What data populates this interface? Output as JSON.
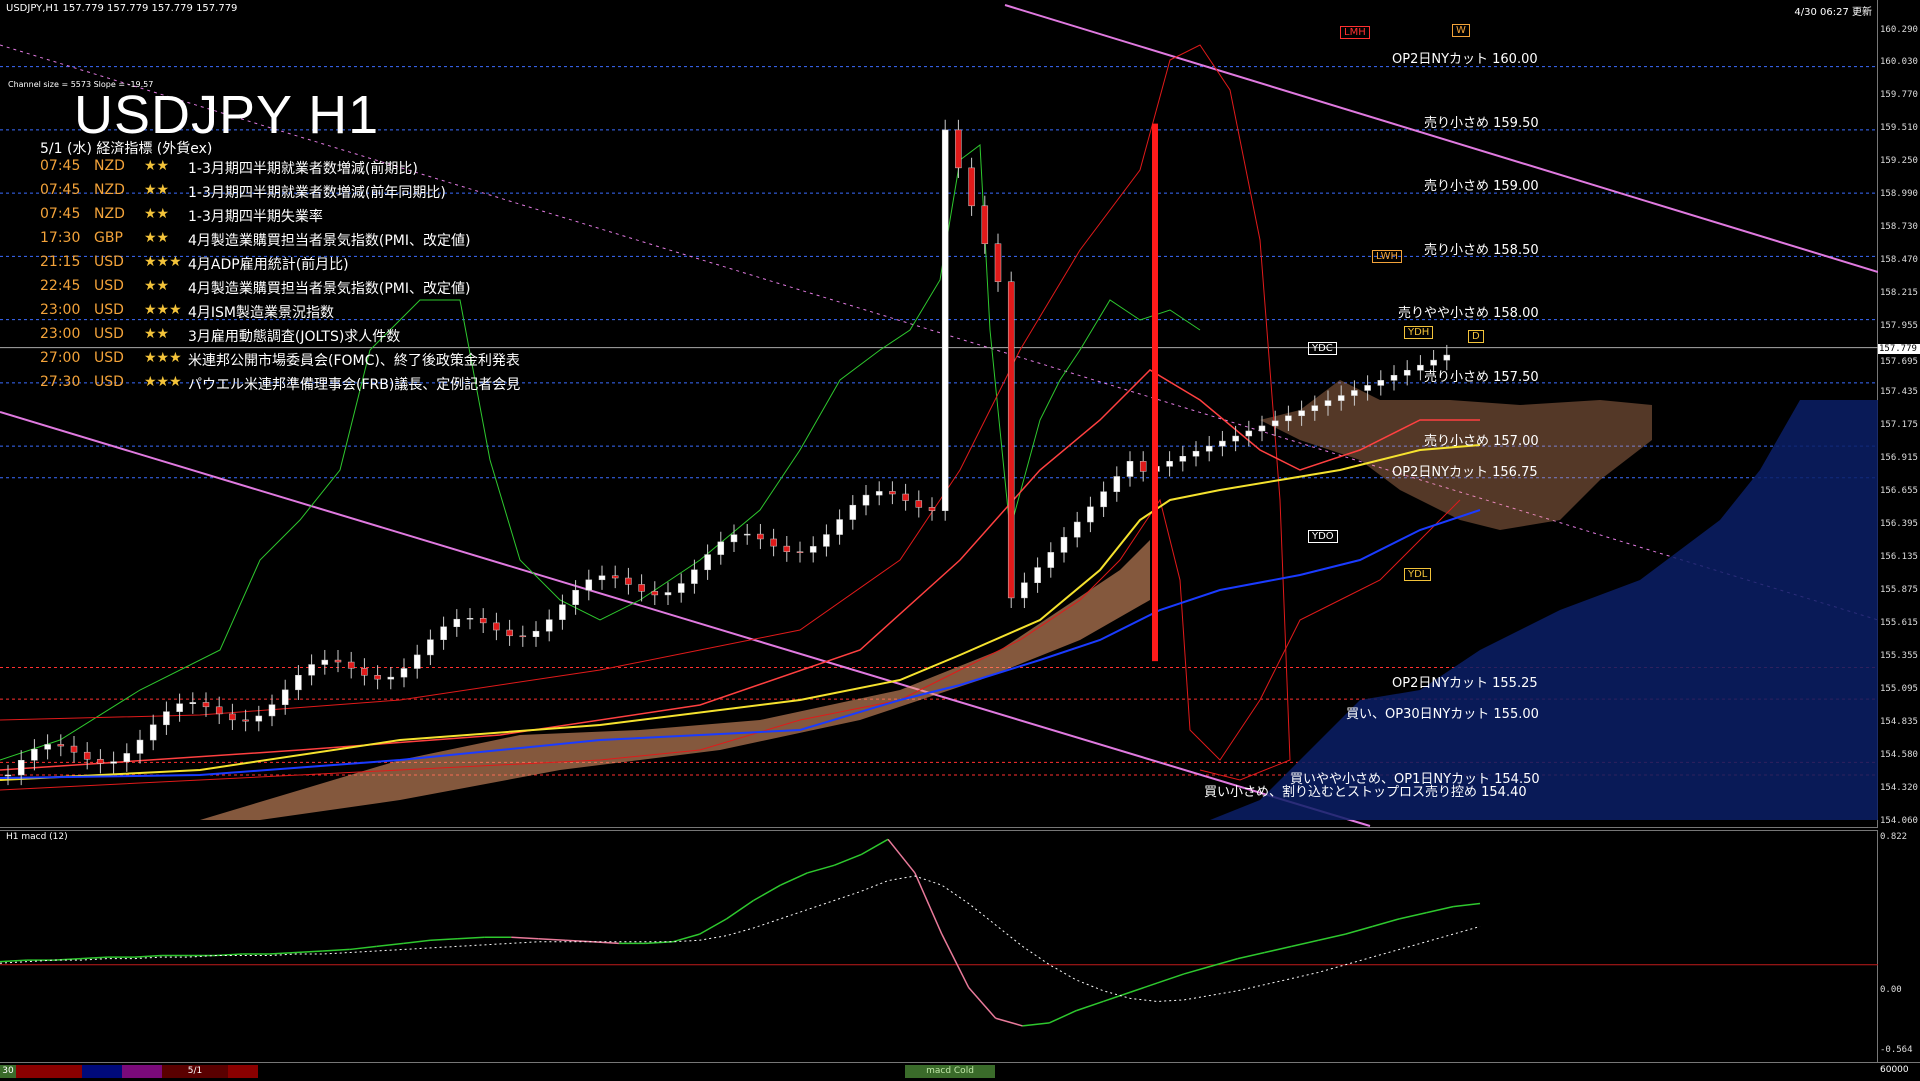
{
  "header": {
    "symbol_line": "USDJPY,H1  157.779 157.779 157.779 157.779",
    "server_time": "4/30 06:27 更新",
    "channel_info": "Channel size = 5573 Slope = -19.57"
  },
  "title": "USDJPY H1",
  "events_date": "5/1 (水) 経済指標 (外貨ex)",
  "events": [
    {
      "time": "07:45",
      "ccy": "NZD",
      "stars": "★★",
      "title": "1-3月期四半期就業者数増減(前期比)"
    },
    {
      "time": "07:45",
      "ccy": "NZD",
      "stars": "★★",
      "title": "1-3月期四半期就業者数増減(前年同期比)"
    },
    {
      "time": "07:45",
      "ccy": "NZD",
      "stars": "★★",
      "title": "1-3月期四半期失業率"
    },
    {
      "time": "17:30",
      "ccy": "GBP",
      "stars": "★★",
      "title": "4月製造業購買担当者景気指数(PMI、改定値)"
    },
    {
      "time": "21:15",
      "ccy": "USD",
      "stars": "★★★",
      "title": "4月ADP雇用統計(前月比)"
    },
    {
      "time": "22:45",
      "ccy": "USD",
      "stars": "★★",
      "title": "4月製造業購買担当者景気指数(PMI、改定値)"
    },
    {
      "time": "23:00",
      "ccy": "USD",
      "stars": "★★★",
      "title": "4月ISM製造業景況指数"
    },
    {
      "time": "23:00",
      "ccy": "USD",
      "stars": "★★",
      "title": "3月雇用動態調査(JOLTS)求人件数"
    },
    {
      "time": "27:00",
      "ccy": "USD",
      "stars": "★★★",
      "title": "米連邦公開市場委員会(FOMC)、終了後政策金利発表"
    },
    {
      "time": "27:30",
      "ccy": "USD",
      "stars": "★★★",
      "title": "パウエル米連邦準備理事会(FRB)議長、定例記者会見"
    }
  ],
  "levels": [
    {
      "label": "OP2日NYカット 160.00",
      "price": 160.0,
      "color": "#3b6cff"
    },
    {
      "label": "売り小さめ 159.50",
      "price": 159.5,
      "color": "#3b6cff"
    },
    {
      "label": "売り小さめ 159.00",
      "price": 159.0,
      "color": "#3b6cff"
    },
    {
      "label": "売り小さめ 158.50",
      "price": 158.5,
      "color": "#3b6cff"
    },
    {
      "label": "売りやや小さめ 158.00",
      "price": 158.0,
      "color": "#3b6cff"
    },
    {
      "label": "売り小さめ 157.50",
      "price": 157.5,
      "color": "#3b6cff"
    },
    {
      "label": "売り小さめ 157.00",
      "price": 157.0,
      "color": "#3b6cff"
    },
    {
      "label": "OP2日NYカット 156.75",
      "price": 156.75,
      "color": "#3b6cff"
    },
    {
      "label": "OP2日NYカット 155.25",
      "price": 155.25,
      "color": "#ff3030"
    },
    {
      "label": "買い、OP30日NYカット 155.00",
      "price": 155.0,
      "color": "#ff3030"
    },
    {
      "label": "買いやや小さめ、OP1日NYカット 154.50",
      "price": 154.5,
      "color": "#ff3030"
    },
    {
      "label": "買い小さめ、割り込むとストップロス売り控め 154.40",
      "price": 154.4,
      "color": "#ff3030"
    }
  ],
  "tags": [
    {
      "text": "LMH",
      "color": "#ff3030"
    },
    {
      "text": "W",
      "color": "#f3a33a"
    },
    {
      "text": "LWH",
      "color": "#f3a33a"
    },
    {
      "text": "YDH",
      "color": "#f3c33a"
    },
    {
      "text": "D",
      "color": "#f3c33a"
    },
    {
      "text": "YDC",
      "color": "#ffffff"
    },
    {
      "text": "YDO",
      "color": "#ffffff"
    },
    {
      "text": "YDL",
      "color": "#f3c33a"
    }
  ],
  "price_axis": {
    "ticks": [
      "160.290",
      "160.030",
      "159.770",
      "159.510",
      "159.250",
      "158.990",
      "158.730",
      "158.470",
      "158.215",
      "157.955",
      "157.695",
      "157.435",
      "157.175",
      "156.915",
      "156.655",
      "156.395",
      "156.135",
      "155.875",
      "155.615",
      "155.355",
      "155.095",
      "154.835",
      "154.580",
      "154.320",
      "154.060"
    ],
    "current_price": "157.779",
    "max": 160.29,
    "min": 154.06
  },
  "macd": {
    "label": "H1  macd (12)",
    "ticks": [
      "0.822",
      "0.00",
      "-0.564"
    ],
    "main": [
      0.02,
      0.03,
      0.03,
      0.04,
      0.05,
      0.05,
      0.06,
      0.06,
      0.06,
      0.07,
      0.07,
      0.08,
      0.09,
      0.1,
      0.12,
      0.14,
      0.16,
      0.17,
      0.18,
      0.18,
      0.17,
      0.16,
      0.15,
      0.14,
      0.14,
      0.15,
      0.2,
      0.3,
      0.42,
      0.52,
      0.6,
      0.65,
      0.72,
      0.82,
      0.6,
      0.2,
      -0.15,
      -0.35,
      -0.4,
      -0.38,
      -0.3,
      -0.24,
      -0.18,
      -0.12,
      -0.06,
      -0.01,
      0.04,
      0.08,
      0.12,
      0.16,
      0.2,
      0.25,
      0.3,
      0.34,
      0.38,
      0.4
    ],
    "signal": [
      0.01,
      0.02,
      0.03,
      0.03,
      0.04,
      0.04,
      0.05,
      0.05,
      0.06,
      0.06,
      0.06,
      0.07,
      0.07,
      0.08,
      0.09,
      0.1,
      0.11,
      0.12,
      0.13,
      0.14,
      0.15,
      0.15,
      0.15,
      0.15,
      0.15,
      0.15,
      0.16,
      0.19,
      0.24,
      0.3,
      0.36,
      0.42,
      0.48,
      0.55,
      0.58,
      0.52,
      0.4,
      0.26,
      0.12,
      0.0,
      -0.1,
      -0.17,
      -0.22,
      -0.24,
      -0.23,
      -0.2,
      -0.17,
      -0.13,
      -0.09,
      -0.05,
      0.0,
      0.05,
      0.1,
      0.15,
      0.2,
      0.25
    ]
  },
  "bottom_bar": {
    "left_label": "30",
    "date_label": "5/1",
    "tab_label": "macd Cold",
    "right_label": "60000"
  }
}
